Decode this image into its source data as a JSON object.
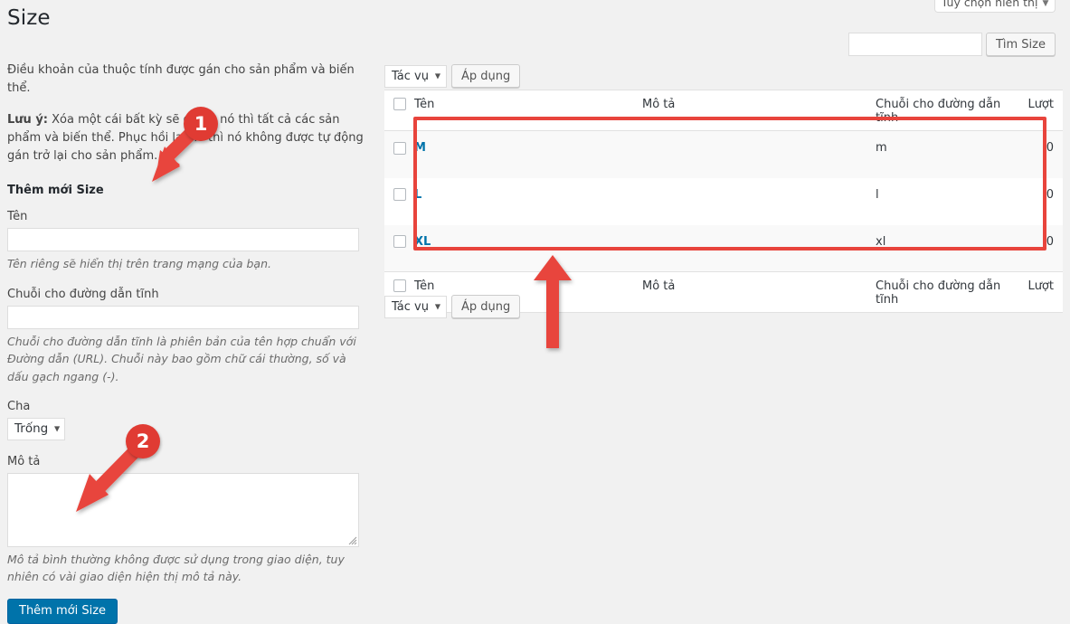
{
  "page": {
    "title": "Size",
    "screen_options_label": "Tùy chọn hiển thị",
    "screen_options_caret": "▼"
  },
  "left_form": {
    "intro": "Điều khoản của thuộc tính được gán cho sản phẩm và biến thể.",
    "note_prefix": "Lưu ý:",
    "note_body": " Xóa một cái bất kỳ sẽ gỡ bỏ nó thì tất cả các sản phẩm và biến thể. Phục hồi lại nó thì nó không được tự động gán trở lại cho sản phẩm.",
    "heading": "Thêm mới Size",
    "name_label": "Tên",
    "name_value": "",
    "name_placeholder": "",
    "name_help": "Tên riêng sẽ hiển thị trên trang mạng của bạn.",
    "slug_label": "Chuỗi cho đường dẫn tĩnh",
    "slug_value": "",
    "slug_placeholder": "",
    "slug_help": "Chuỗi cho đường dẫn tĩnh là phiên bản của tên hợp chuẩn với Đường dẫn (URL). Chuỗi này bao gồm chữ cái thường, số và dấu gạch ngang (-).",
    "parent_label": "Cha",
    "parent_value": "Trống",
    "parent_caret": "▼",
    "description_label": "Mô tả",
    "description_value": "",
    "description_help": "Mô tả bình thường không được sử dụng trong giao diện, tuy nhiên có vài giao diện hiện thị mô tả này.",
    "submit_label": "Thêm mới Size"
  },
  "search": {
    "value": "",
    "placeholder": "",
    "button_label": "Tìm Size"
  },
  "bulk_actions": {
    "select_label": "Tác vụ",
    "caret": "▼",
    "apply_label": "Áp dụng"
  },
  "table": {
    "columns": {
      "name": "Tên",
      "description": "Mô tả",
      "slug": "Chuỗi cho đường dẫn tĩnh",
      "count": "Lượt"
    },
    "rows": [
      {
        "name": "M",
        "description": "",
        "slug": "m",
        "count": "0"
      },
      {
        "name": "L",
        "description": "",
        "slug": "l",
        "count": "0"
      },
      {
        "name": "XL",
        "description": "",
        "slug": "xl",
        "count": "0"
      }
    ]
  },
  "annotations": {
    "badge_1": "1",
    "badge_2": "2",
    "highlight_color": "#e8443c",
    "arrow_color": "#e8443c"
  }
}
